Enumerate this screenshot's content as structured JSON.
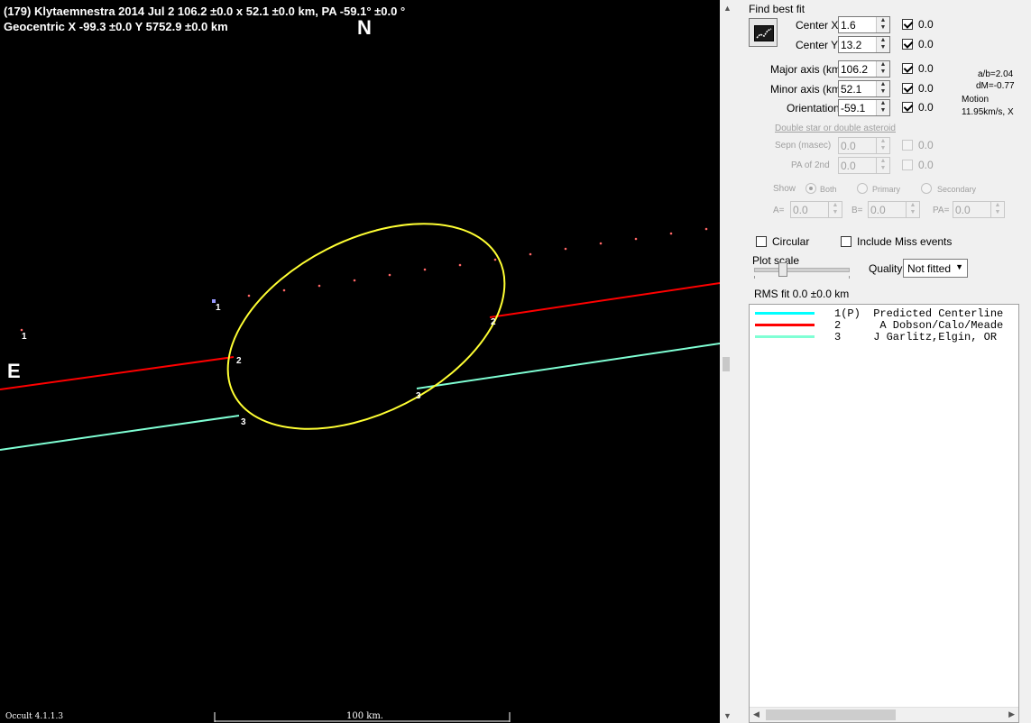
{
  "plot": {
    "header_line1": "(179) Klytaemnestra  2014 Jul 2   106.2 ±0.0 x 52.1 ±0.0 km,  PA -59.1° ±0.0 °",
    "header_line2": "Geocentric X  -99.3 ±0.0  Y 5752.9 ±0.0 km",
    "north_label": "N",
    "east_label": "E",
    "version": "Occult 4.1.1.3",
    "scale_label": "100 km.",
    "point_labels": [
      "1",
      "1",
      "2",
      "2",
      "3",
      "3"
    ],
    "colors": {
      "ellipse": "#ffff33",
      "chord_red": "#ff0000",
      "chord_cyan": "#7fffd4",
      "path_dots": "#ff6666"
    }
  },
  "panel": {
    "find_best_fit": "Find best fit",
    "fit_button_icon": "fit-icon",
    "center_x": {
      "label": "Center X",
      "value": "1.6",
      "checked": true,
      "uncert": "0.0"
    },
    "center_y": {
      "label": "Center Y",
      "value": "13.2",
      "checked": true,
      "uncert": "0.0"
    },
    "major_axis": {
      "label": "Major axis (km)",
      "value": "106.2",
      "checked": true,
      "uncert": "0.0"
    },
    "minor_axis": {
      "label": "Minor axis (km)",
      "value": "52.1",
      "checked": true,
      "uncert": "0.0"
    },
    "orientation": {
      "label": "Orientation",
      "value": "-59.1",
      "checked": true,
      "uncert": "0.0"
    },
    "ab_ratio": "a/b=2.04",
    "dm": "dM=-0.77",
    "motion_label": "Motion",
    "motion_value": "11.95km/s, X",
    "double_star_link": "Double star  or  double asteroid",
    "sepn": {
      "label": "Sepn (masec)",
      "value": "0.0",
      "uncert": "0.0"
    },
    "pa2nd": {
      "label": "PA of 2nd",
      "value": "0.0",
      "uncert": "0.0"
    },
    "show_label": "Show",
    "show_options": [
      "Both",
      "Primary",
      "Secondary"
    ],
    "a_label": "A=",
    "a_value": "0.0",
    "b_label": "B=",
    "b_value": "0.0",
    "pa_label": "PA=",
    "pa_value": "0.0",
    "circular": "Circular",
    "include_miss": "Include Miss events",
    "plot_scale": "Plot scale",
    "quality_label": "Quality",
    "quality_value": "Not fitted",
    "rms_fit": "RMS fit 0.0 ±0.0 km",
    "legend": [
      {
        "text": "1(P)  Predicted Centerline",
        "color": "#00ffff"
      },
      {
        "text": "2      A Dobson/Calo/Meade",
        "color": "#ff0000"
      },
      {
        "text": "3     J Garlitz,Elgin, OR",
        "color": "#7fffd4"
      }
    ]
  }
}
